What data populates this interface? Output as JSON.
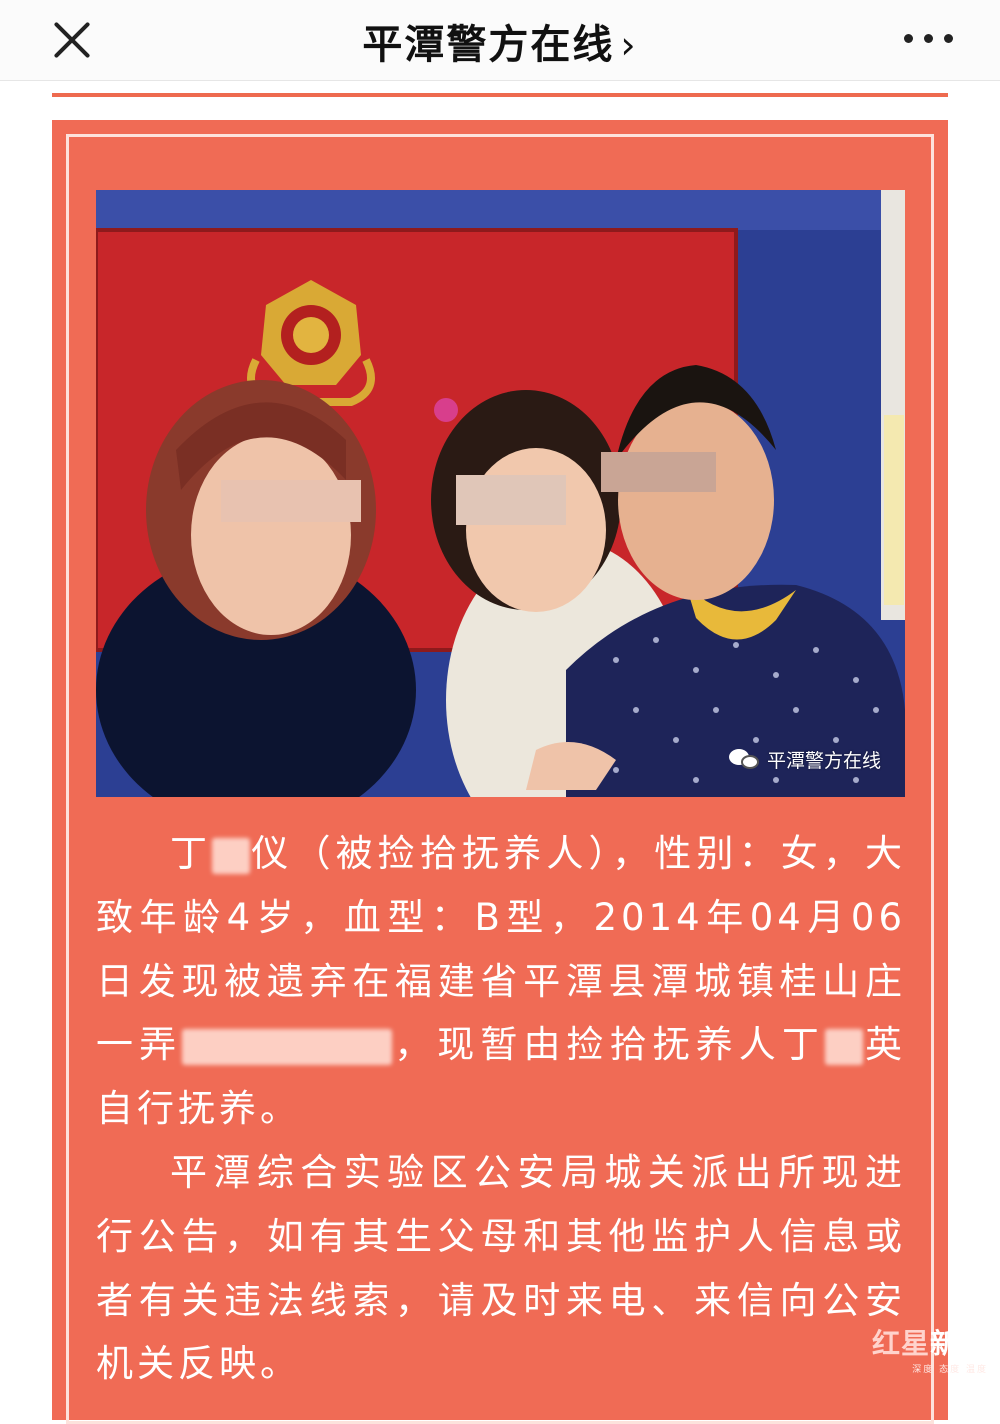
{
  "header": {
    "title": "平潭警方在线",
    "title_chevron": "›",
    "close_icon": "close-icon",
    "more_icon": "more-icon"
  },
  "article": {
    "photo": {
      "description_icon": "photo-family-portrait",
      "watermark": "平潭警方在线"
    },
    "paragraph1": {
      "part1": "丁",
      "part2": "仪（被捡拾抚养人），性别：女，大致年龄4岁，血型：B型，2014年04月06日发现被遗弃在福建省平潭县潭城镇桂山庄一弄",
      "part3": "，现暂由捡拾抚养人丁",
      "part4": "英自行抚养。"
    },
    "paragraph2": "平潭综合实验区公安局城关派出所现进行公告，如有其生父母和其他监护人信息或者有关违法线索，请及时来电、来信向公安机关反映。"
  },
  "corner_logo": {
    "main_red": "红星",
    "main_white": "新闻",
    "sub": "深度 态度 温度"
  },
  "colors": {
    "card_bg": "#f06b55",
    "accent": "#ee6a4f",
    "frame": "#fde2dc"
  }
}
